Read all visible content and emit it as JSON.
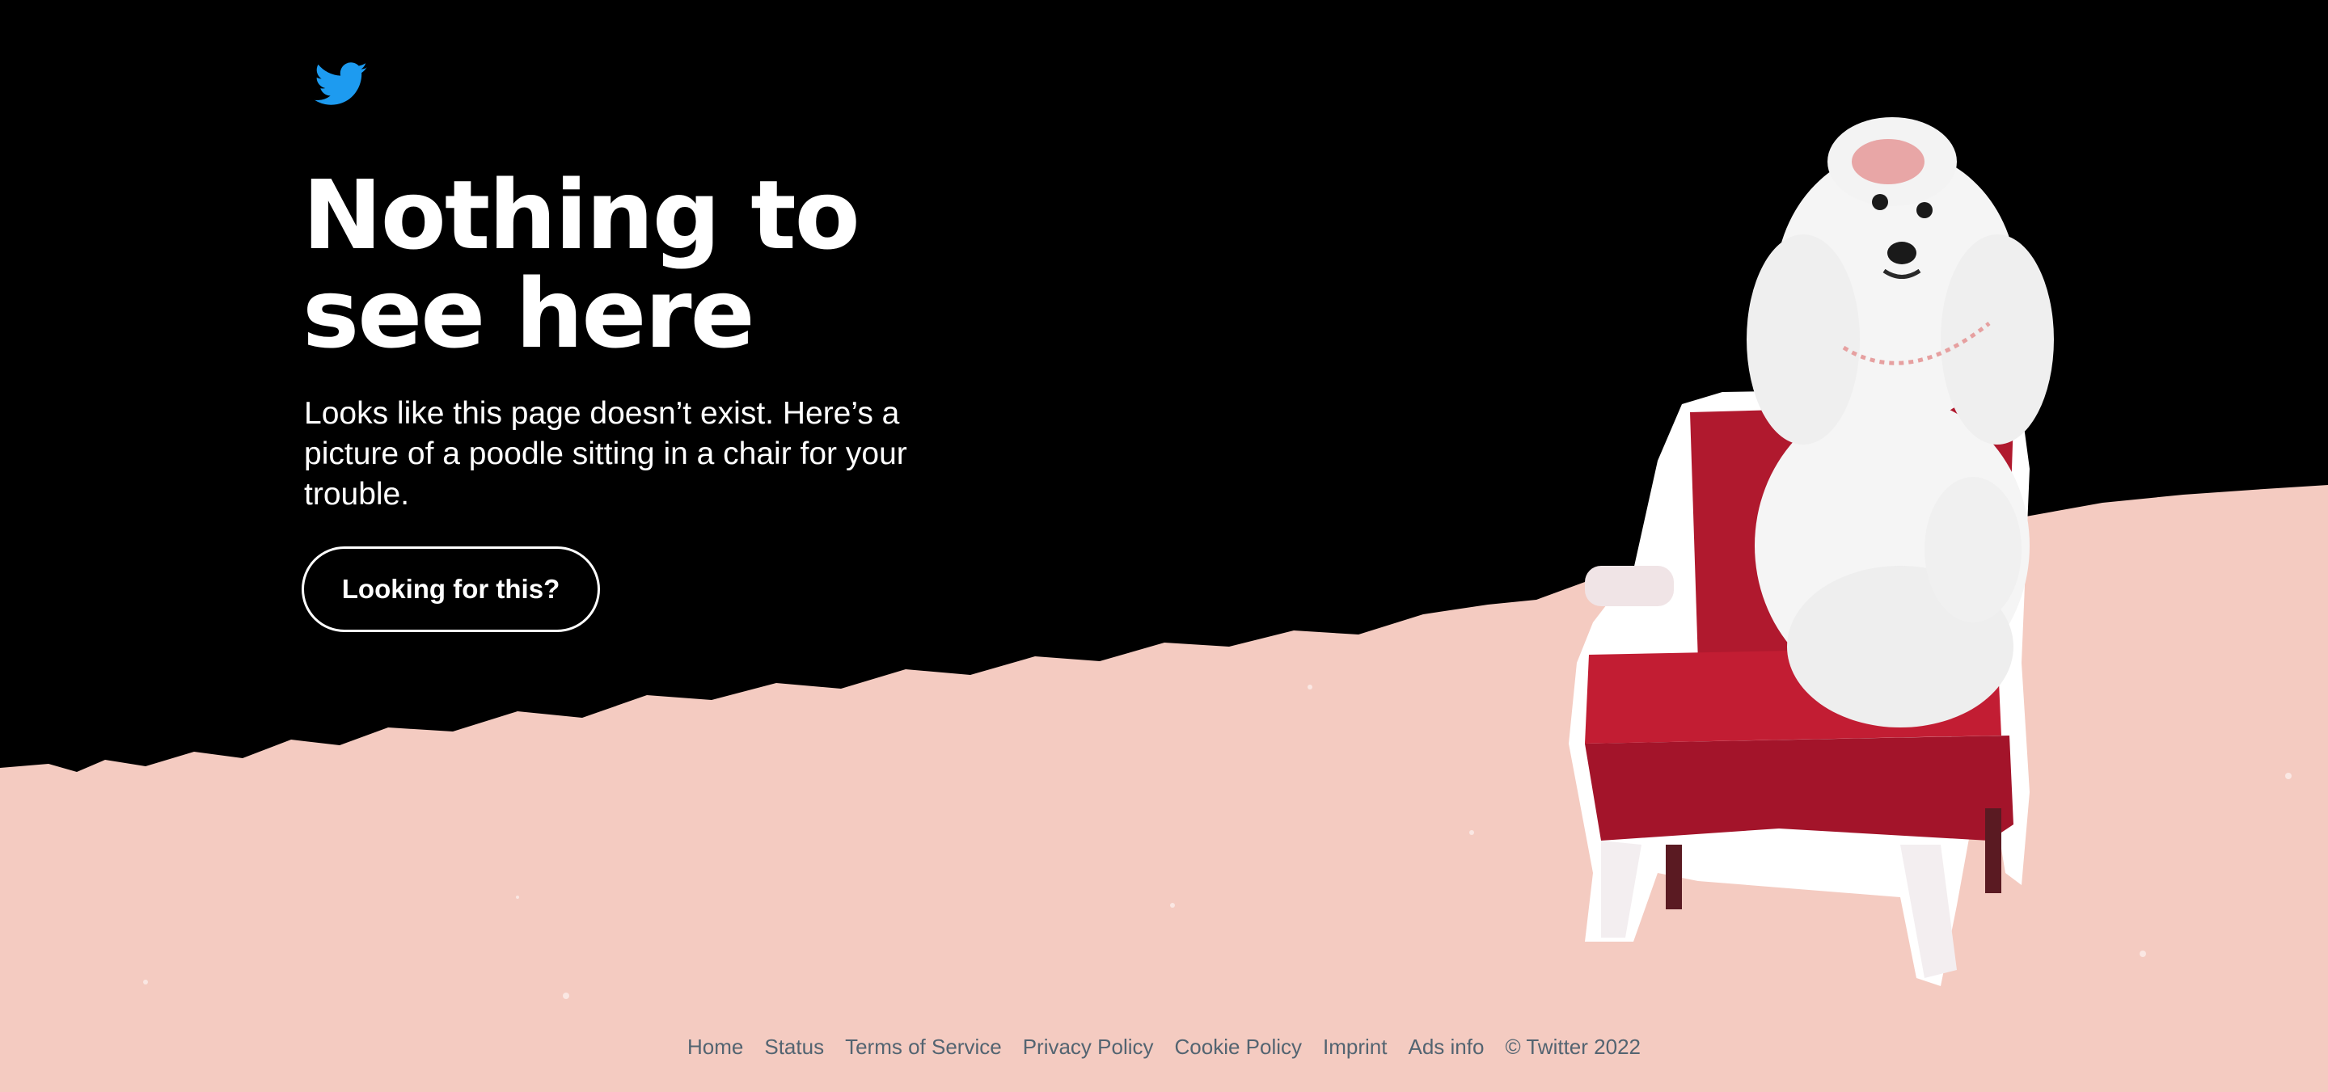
{
  "colors": {
    "background": "#000000",
    "floor": "#f4cbc1",
    "text": "#ffffff",
    "brand": "#1d9bf0",
    "footer_text": "#536471",
    "chair": "#b0192e",
    "poodle": "#f5f5f5"
  },
  "logo": {
    "icon": "twitter-bird-icon"
  },
  "headline": {
    "line1": "Nothing to",
    "line2": "see here"
  },
  "subtext": "Looks like this page doesn’t exist. Here’s a picture of a poodle sitting in a chair for your trouble.",
  "cta": {
    "label": "Looking for this?"
  },
  "illustration": {
    "icon": "poodle-in-chair-illustration"
  },
  "footer": {
    "links": [
      "Home",
      "Status",
      "Terms of Service",
      "Privacy Policy",
      "Cookie Policy",
      "Imprint",
      "Ads info"
    ],
    "copyright": "© Twitter 2022"
  }
}
